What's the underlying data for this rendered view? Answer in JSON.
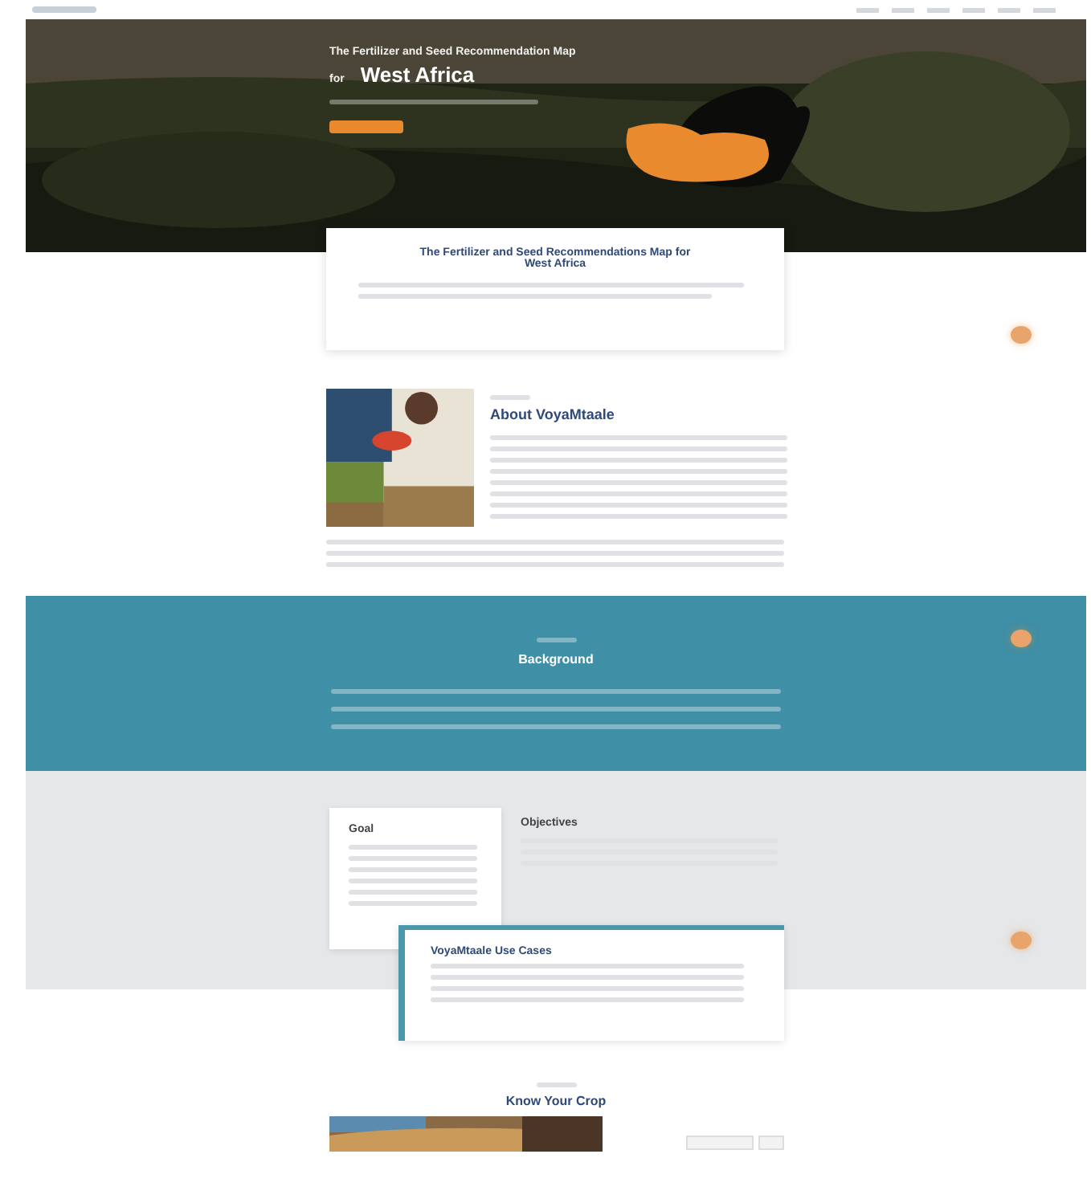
{
  "hero": {
    "title_line": "The Fertilizer and Seed Recommendation Map",
    "title_prefix": "for",
    "title_big": "West Africa"
  },
  "intro_card": {
    "title": "The Fertilizer and Seed Recommendations Map for West Africa"
  },
  "about": {
    "title": "About VoyaMtaale"
  },
  "background": {
    "title": "Background"
  },
  "goal": {
    "title": "Goal"
  },
  "objectives": {
    "title": "Objectives"
  },
  "use_cases": {
    "title": "VoyaMtaale Use Cases"
  },
  "crops": {
    "title": "Know Your Crop"
  }
}
